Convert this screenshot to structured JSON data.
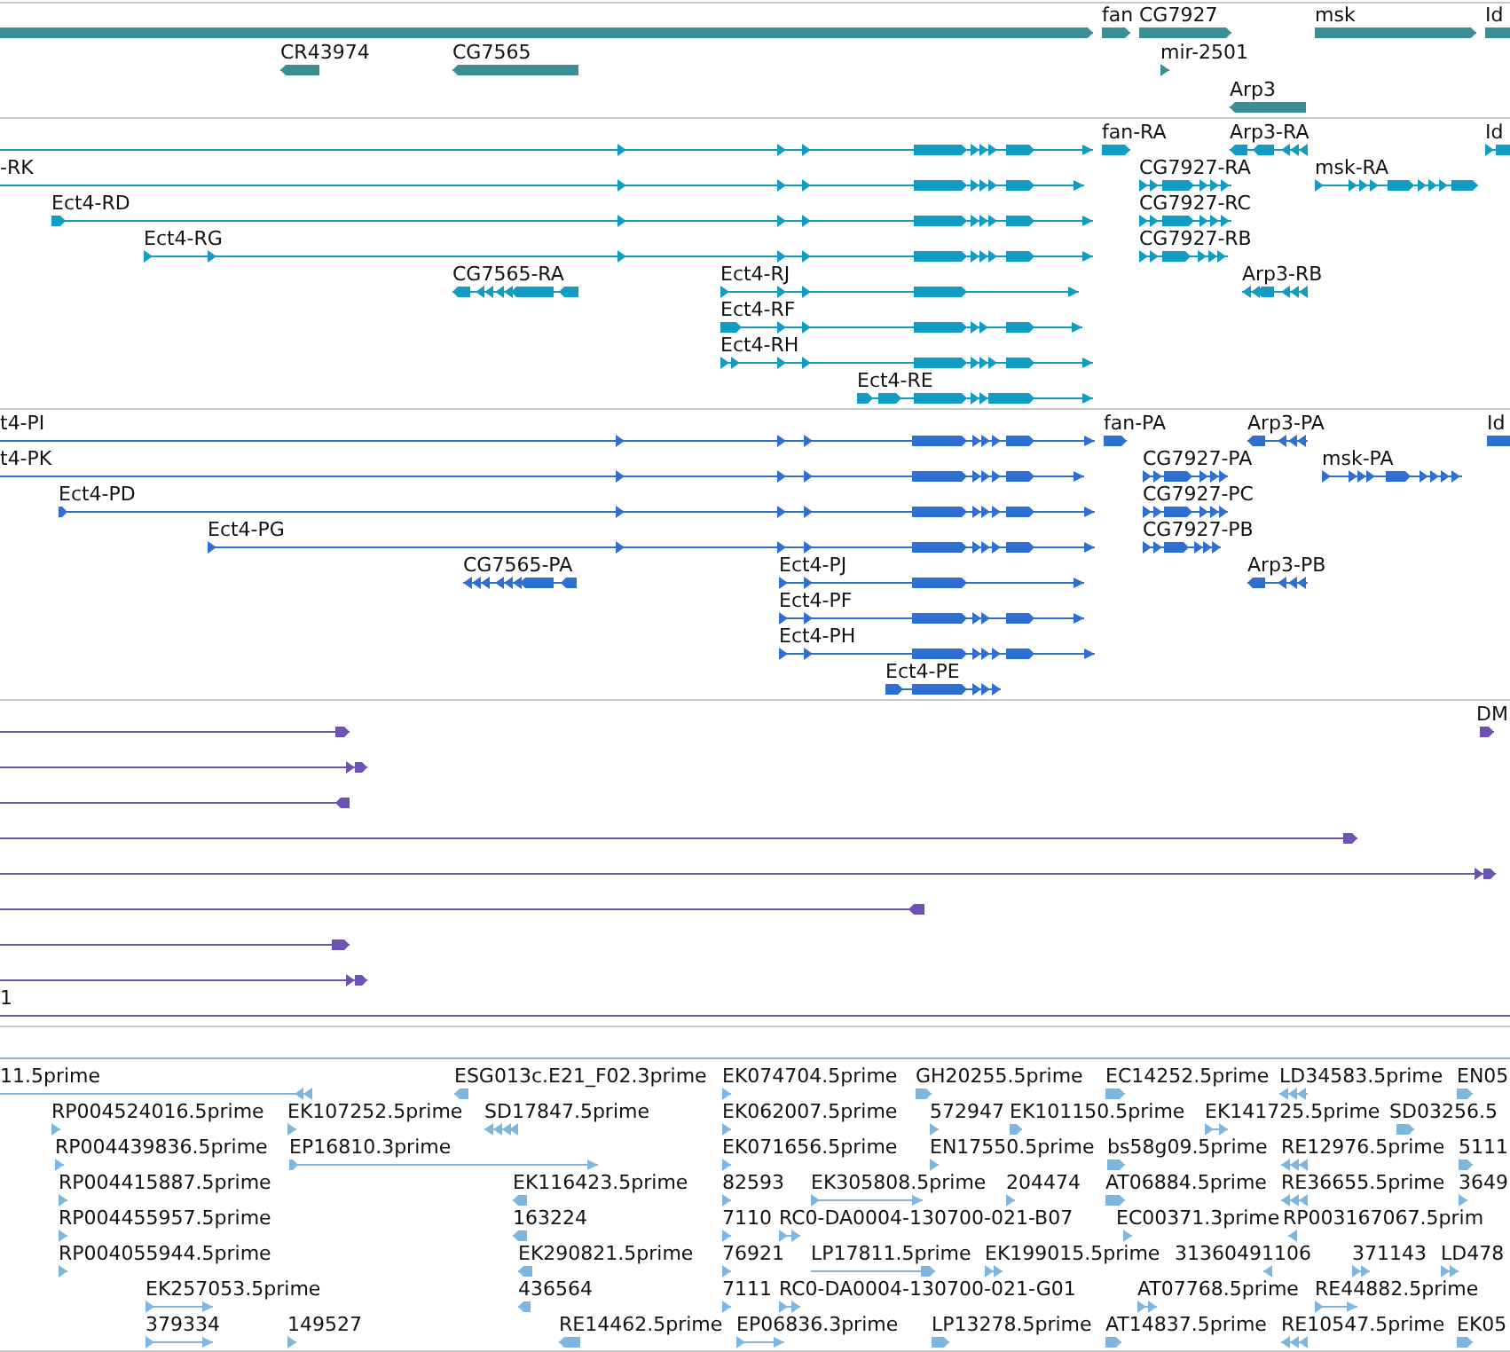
{
  "tracks": [
    {
      "kind": "gene",
      "rows": [
        [
          {
            "reverse": false
          },
          {
            "label": "fan",
            "reverse": false
          },
          {
            "label": "CG7927",
            "reverse": false
          },
          {
            "label": "msk",
            "reverse": false
          },
          {
            "label": "Id",
            "reverse": false
          }
        ],
        [
          {
            "label": "CR43974",
            "reverse": true
          },
          {
            "label": "CG7565",
            "reverse": true
          },
          {
            "label": "mir-2501",
            "reverse": false
          }
        ],
        [
          {
            "label": "Arp3",
            "reverse": true
          }
        ]
      ]
    },
    {
      "kind": "transcript",
      "rows": [
        [
          {
            "reverse": false
          },
          {
            "label": "fan-RA",
            "reverse": false
          },
          {
            "label": "Arp3-RA",
            "reverse": true
          },
          {
            "label": "Id",
            "reverse": false
          }
        ],
        [
          {
            "label": "-RK",
            "reverse": false
          },
          {
            "label": "CG7927-RA",
            "reverse": false
          },
          {
            "label": "msk-RA",
            "reverse": false
          }
        ],
        [
          {
            "label": "Ect4-RD",
            "reverse": false
          },
          {
            "label": "CG7927-RC",
            "reverse": false
          }
        ],
        [
          {
            "label": "Ect4-RG",
            "reverse": false
          },
          {
            "label": "CG7927-RB",
            "reverse": false
          }
        ],
        [
          {
            "label": "CG7565-RA",
            "reverse": true
          },
          {
            "label": "Ect4-RJ",
            "reverse": false
          },
          {
            "label": "Arp3-RB",
            "reverse": true
          }
        ],
        [
          {
            "label": "Ect4-RF",
            "reverse": false
          }
        ],
        [
          {
            "label": "Ect4-RH",
            "reverse": false
          }
        ],
        [
          {
            "label": "Ect4-RE",
            "reverse": false
          }
        ]
      ]
    },
    {
      "kind": "protein",
      "rows": [
        [
          {
            "label": "t4-PI",
            "reverse": false
          },
          {
            "label": "fan-PA",
            "reverse": false
          },
          {
            "label": "Arp3-PA",
            "reverse": true
          },
          {
            "label": "Id",
            "reverse": false
          }
        ],
        [
          {
            "label": "t4-PK",
            "reverse": false
          },
          {
            "label": "CG7927-PA",
            "reverse": false
          },
          {
            "label": "msk-PA",
            "reverse": false
          }
        ],
        [
          {
            "label": "Ect4-PD",
            "reverse": false
          },
          {
            "label": "CG7927-PC",
            "reverse": false
          }
        ],
        [
          {
            "label": "Ect4-PG",
            "reverse": false
          },
          {
            "label": "CG7927-PB",
            "reverse": false
          }
        ],
        [
          {
            "label": "CG7565-PA",
            "reverse": true
          },
          {
            "label": "Ect4-PJ",
            "reverse": false
          },
          {
            "label": "Arp3-PB",
            "reverse": true
          }
        ],
        [
          {
            "label": "Ect4-PF",
            "reverse": false
          }
        ],
        [
          {
            "label": "Ect4-PH",
            "reverse": false
          }
        ],
        [
          {
            "label": "Ect4-PE",
            "reverse": false
          }
        ]
      ]
    },
    {
      "kind": "alignment",
      "rows": [
        [
          {
            "reverse": false
          },
          {
            "label": "DM",
            "reverse": false
          }
        ],
        [
          {
            "reverse": false
          }
        ],
        [
          {
            "reverse": true
          }
        ],
        [
          {
            "reverse": false
          }
        ],
        [
          {
            "reverse": false
          }
        ],
        [
          {
            "reverse": true
          }
        ],
        [
          {
            "reverse": false
          }
        ],
        [
          {
            "reverse": false
          }
        ],
        [
          {
            "label": "1"
          }
        ]
      ]
    },
    {
      "kind": "est",
      "rows": [
        [
          {}
        ],
        [
          {
            "label": "11.5prime",
            "reverse": true
          },
          {
            "label": "ESG013c.E21_F02.3prime",
            "reverse": true
          },
          {
            "label": "EK074704.5prime",
            "reverse": false
          },
          {
            "label": "GH20255.5prime",
            "reverse": false
          },
          {
            "label": "EC14252.5prime",
            "reverse": false
          },
          {
            "label": "LD34583.5prime",
            "reverse": true
          },
          {
            "label": "EN05",
            "reverse": false
          }
        ],
        [
          {
            "label": "RP004524016.5prime",
            "reverse": false
          },
          {
            "label": "EK107252.5prime",
            "reverse": false
          },
          {
            "label": "SD17847.5prime",
            "reverse": true
          },
          {
            "label": "EK062007.5prime",
            "reverse": false
          },
          {
            "label": "572947",
            "reverse": false
          },
          {
            "label": "EK101150.5prime",
            "reverse": false
          },
          {
            "label": "EK141725.5prime",
            "reverse": false
          },
          {
            "label": "SD03256.5",
            "reverse": false
          }
        ],
        [
          {
            "label": "RP004439836.5prime",
            "reverse": false
          },
          {
            "label": "EP16810.3prime",
            "reverse": false
          },
          {
            "label": "EK071656.5prime",
            "reverse": false
          },
          {
            "label": "EN17550.5prime",
            "reverse": false
          },
          {
            "label": "bs58g09.5prime",
            "reverse": false
          },
          {
            "label": "RE12976.5prime",
            "reverse": true
          },
          {
            "label": "5111",
            "reverse": false
          }
        ],
        [
          {
            "label": "RP004415887.5prime",
            "reverse": false
          },
          {
            "label": "EK116423.5prime",
            "reverse": true
          },
          {
            "label": "82593",
            "reverse": false
          },
          {
            "label": "EK305808.5prime",
            "reverse": false
          },
          {
            "label": "204474",
            "reverse": false
          },
          {
            "label": "AT06884.5prime",
            "reverse": false
          },
          {
            "label": "RE36655.5prime",
            "reverse": true
          },
          {
            "label": "3649",
            "reverse": false
          }
        ],
        [
          {
            "label": "RP004455957.5prime",
            "reverse": false
          },
          {
            "label": "163224",
            "reverse": true
          },
          {
            "label": "7110",
            "reverse": false
          },
          {
            "label": "RC0-DA0004-130700-021-B07",
            "reverse": false
          },
          {
            "label": "EC00371.3prime",
            "reverse": false
          },
          {
            "label": "RP003167067.5prim",
            "reverse": true
          }
        ],
        [
          {
            "label": "RP004055944.5prime",
            "reverse": false
          },
          {
            "label": "EK290821.5prime",
            "reverse": true
          },
          {
            "label": "76921",
            "reverse": false
          },
          {
            "label": "LP17811.5prime",
            "reverse": false
          },
          {
            "label": "EK199015.5prime",
            "reverse": false
          },
          {
            "label": "31360491106",
            "reverse": true
          },
          {
            "label": "371143",
            "reverse": false
          },
          {
            "label": "LD478",
            "reverse": false
          }
        ],
        [
          {
            "label": "EK257053.5prime",
            "reverse": false
          },
          {
            "label": "436564",
            "reverse": true
          },
          {
            "label": "7111",
            "reverse": false
          },
          {
            "label": "RC0-DA0004-130700-021-G01",
            "reverse": false
          },
          {
            "label": "AT07768.5prime",
            "reverse": false
          },
          {
            "label": "RE44882.5prime",
            "reverse": false
          }
        ],
        [
          {
            "label": "379334",
            "reverse": false
          },
          {
            "label": "149527",
            "reverse": false
          },
          {
            "label": "RE14462.5prime",
            "reverse": true
          },
          {
            "label": "EP06836.3prime",
            "reverse": false
          },
          {
            "label": "LP13278.5prime",
            "reverse": false
          },
          {
            "label": "AT14837.5prime",
            "reverse": false
          },
          {
            "label": "RE10547.5prime",
            "reverse": true
          },
          {
            "label": "EK05",
            "reverse": false
          }
        ]
      ]
    }
  ]
}
